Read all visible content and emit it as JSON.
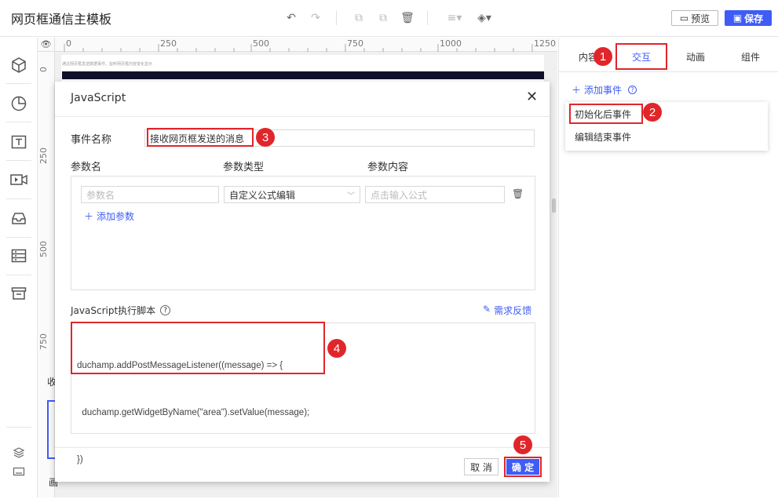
{
  "app": {
    "title": "网页框通信主模板"
  },
  "toolbar": {
    "undo_icon": "undo-icon",
    "redo_icon": "redo-icon",
    "copy_icon": "copy-icon",
    "paste_icon": "paste-icon",
    "delete_icon": "delete-icon",
    "align_icon": "align-icon",
    "layer_icon": "layer-icon",
    "preview_label": "预览",
    "save_label": "保存",
    "accent": "#3f5cf6"
  },
  "left_sidebar": {
    "icons": [
      "cube-icon",
      "pie-chart-icon",
      "text-icon",
      "video-icon",
      "inbox-icon",
      "list-icon",
      "archive-icon"
    ],
    "bottom_icons": [
      "layers-icon",
      "keyboard-icon"
    ]
  },
  "canvas": {
    "ruler_top": [
      "0",
      "250",
      "500",
      "750",
      "1000",
      "1250"
    ],
    "ruler_left": [
      "0",
      "250",
      "500",
      "750"
    ],
    "banner_text": "通过网页框发送数据事件，监听网页框内容变化显示",
    "partial_label": "收",
    "bottom_status": "画"
  },
  "right_panel": {
    "tabs": [
      "内容",
      "交互",
      "动画",
      "组件"
    ],
    "active_tab": "交互",
    "add_event_label": "添加事件",
    "events": [
      "初始化后事件",
      "编辑结束事件"
    ]
  },
  "modal": {
    "title": "JavaScript",
    "event_name_label": "事件名称",
    "event_name_value": "接收网页框发送的消息",
    "param_headers": [
      "参数名",
      "参数类型",
      "参数内容"
    ],
    "param_name_placeholder": "参数名",
    "param_type_value": "自定义公式编辑",
    "param_content_placeholder": "点击输入公式",
    "add_param_label": "添加参数",
    "script_label": "JavaScript执行脚本",
    "feedback_label": "需求反馈",
    "script_lines": [
      "duchamp.addPostMessageListener((message) => {",
      "  duchamp.getWidgetByName(\"area\").setValue(message);",
      "})"
    ],
    "cancel_label": "取 消",
    "confirm_label": "确 定"
  },
  "annotations": [
    "1",
    "2",
    "3",
    "4",
    "5"
  ],
  "colors": {
    "highlight": "#e0262a",
    "link": "#3f5cf6"
  }
}
